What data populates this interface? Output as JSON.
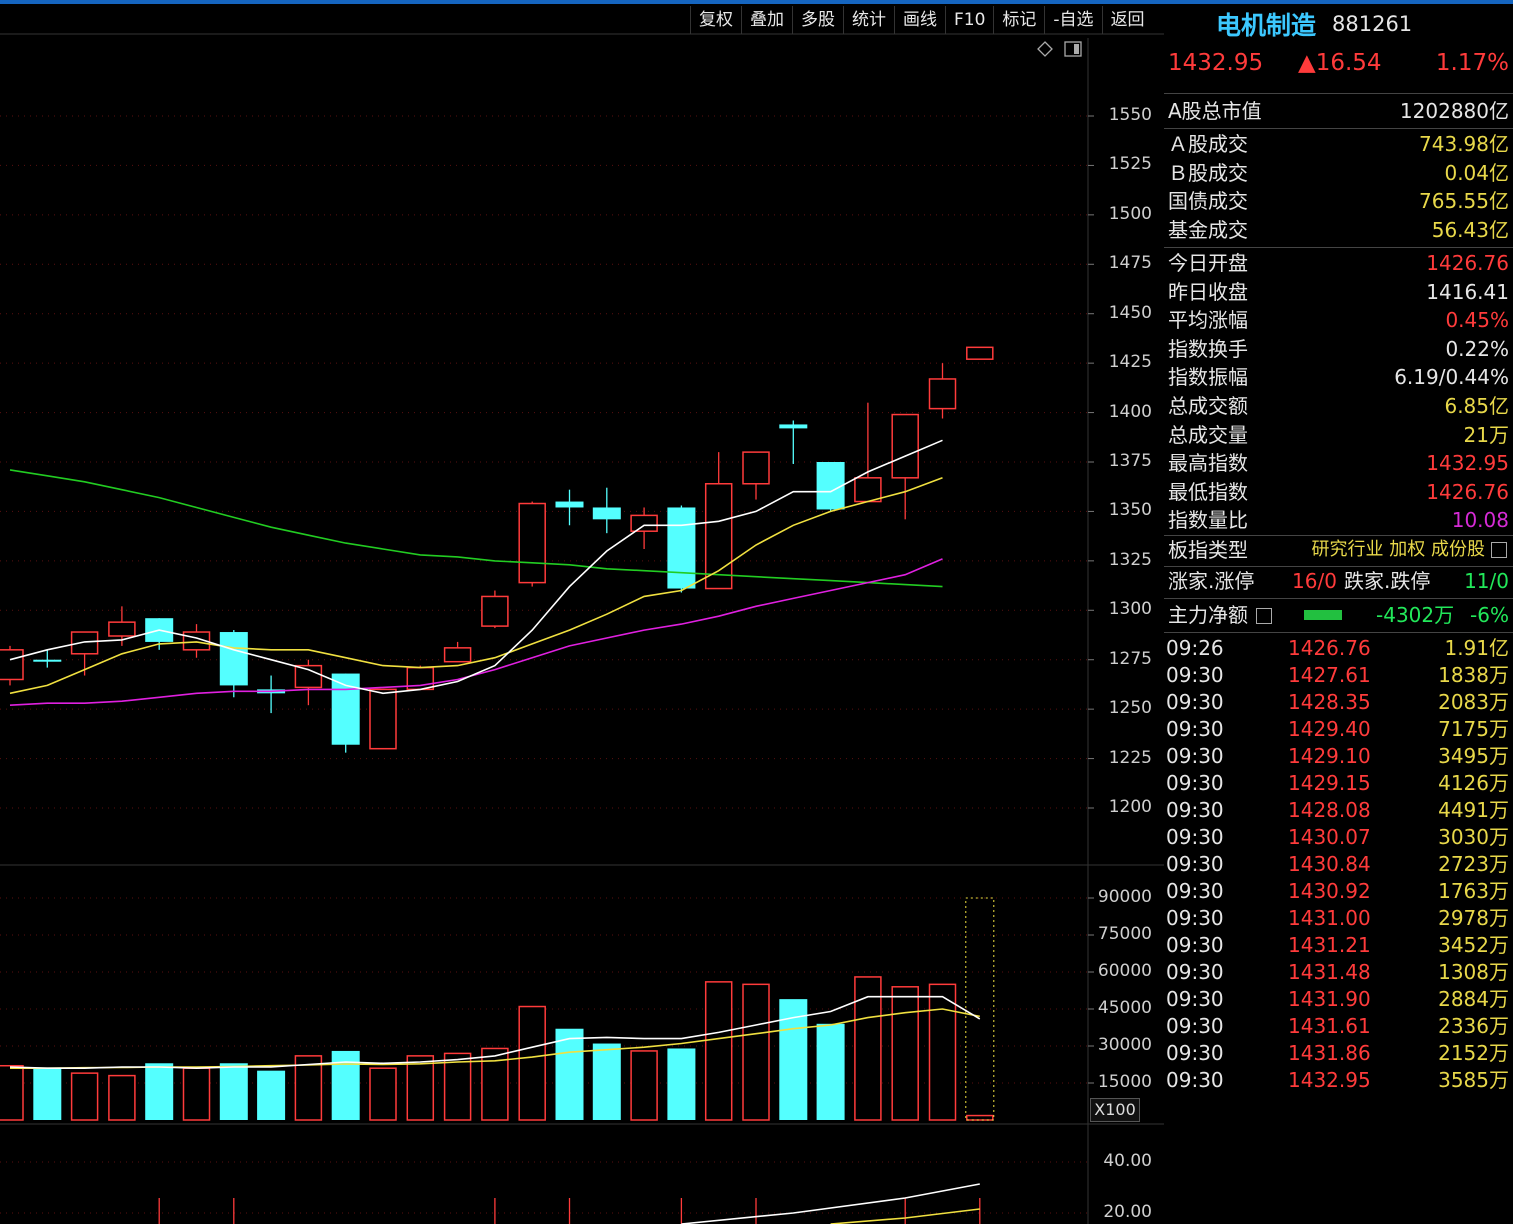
{
  "toolbar": {
    "items": [
      "复权",
      "叠加",
      "多股",
      "统计",
      "画线",
      "F10",
      "标记",
      "-自选",
      "返回"
    ]
  },
  "header": {
    "name": "电机制造",
    "code": "881261"
  },
  "quote": {
    "price": "1432.95",
    "change": "▲16.54",
    "pct": "1.17%"
  },
  "stats_top": [
    {
      "k": "A股总市值",
      "v": "1202880亿",
      "c": "wht"
    }
  ],
  "stats_a": [
    {
      "k": "Ａ股成交",
      "v": "743.98亿",
      "c": "yel"
    },
    {
      "k": "Ｂ股成交",
      "v": "0.04亿",
      "c": "yel"
    },
    {
      "k": "国债成交",
      "v": "765.55亿",
      "c": "yel"
    },
    {
      "k": "基金成交",
      "v": "56.43亿",
      "c": "yel"
    }
  ],
  "stats_b": [
    {
      "k": "今日开盘",
      "v": "1426.76",
      "c": "red"
    },
    {
      "k": "昨日收盘",
      "v": "1416.41",
      "c": "wht"
    },
    {
      "k": "平均涨幅",
      "v": "0.45%",
      "c": "red"
    },
    {
      "k": "指数换手",
      "v": "0.22%",
      "c": "wht"
    },
    {
      "k": "指数振幅",
      "v": "6.19/0.44%",
      "c": "wht"
    },
    {
      "k": "总成交额",
      "v": "6.85亿",
      "c": "yel"
    },
    {
      "k": "总成交量",
      "v": "21万",
      "c": "yel"
    },
    {
      "k": "最高指数",
      "v": "1432.95",
      "c": "red"
    },
    {
      "k": "最低指数",
      "v": "1426.76",
      "c": "red"
    },
    {
      "k": "指数量比",
      "v": "10.08",
      "c": "mag"
    }
  ],
  "board": {
    "k": "板指类型",
    "v": "研究行业 加权 成份股"
  },
  "updown": {
    "up_label": "涨家.涨停",
    "up_val": "16/0",
    "down_label": "跌家.跌停",
    "down_val": "11/0"
  },
  "mainflow": {
    "k": "主力净额",
    "amount": "-4302万",
    "pct": "-6%"
  },
  "ticks": [
    [
      "09:26",
      "1426.76",
      "1.91亿"
    ],
    [
      "09:30",
      "1427.61",
      "1838万"
    ],
    [
      "09:30",
      "1428.35",
      "2083万"
    ],
    [
      "09:30",
      "1429.40",
      "7175万"
    ],
    [
      "09:30",
      "1429.10",
      "3495万"
    ],
    [
      "09:30",
      "1429.15",
      "4126万"
    ],
    [
      "09:30",
      "1428.08",
      "4491万"
    ],
    [
      "09:30",
      "1430.07",
      "3030万"
    ],
    [
      "09:30",
      "1430.84",
      "2723万"
    ],
    [
      "09:30",
      "1430.92",
      "1763万"
    ],
    [
      "09:30",
      "1431.00",
      "2978万"
    ],
    [
      "09:30",
      "1431.21",
      "3452万"
    ],
    [
      "09:30",
      "1431.48",
      "1308万"
    ],
    [
      "09:30",
      "1431.90",
      "2884万"
    ],
    [
      "09:30",
      "1431.61",
      "2336万"
    ],
    [
      "09:30",
      "1431.86",
      "2152万"
    ],
    [
      "09:30",
      "1432.95",
      "3585万"
    ]
  ],
  "colors": {
    "up": "#ff3b3b",
    "down": "#54ffff",
    "ma5": "#ffffff",
    "ma10": "#f0e040",
    "ma20": "#e020e0",
    "ma60": "#22cc22",
    "grid": "#5a1010"
  },
  "chart_data": [
    {
      "type": "candlestick",
      "price_axis_ticks": [
        "1550",
        "1525",
        "1500",
        "1475",
        "1450",
        "1425",
        "1400",
        "1375",
        "1350",
        "1325",
        "1300",
        "1275",
        "1250",
        "1225",
        "1200"
      ],
      "ylim": [
        1200,
        1550
      ],
      "candles": [
        {
          "o": 1265,
          "h": 1282,
          "l": 1262,
          "c": 1280
        },
        {
          "o": 1275,
          "h": 1280,
          "l": 1271,
          "c": 1274
        },
        {
          "o": 1278,
          "h": 1289,
          "l": 1267,
          "c": 1289
        },
        {
          "o": 1287,
          "h": 1302,
          "l": 1282,
          "c": 1294
        },
        {
          "o": 1296,
          "h": 1296,
          "l": 1280,
          "c": 1284
        },
        {
          "o": 1280,
          "h": 1293,
          "l": 1276,
          "c": 1289
        },
        {
          "o": 1289,
          "h": 1290,
          "l": 1256,
          "c": 1262
        },
        {
          "o": 1260,
          "h": 1267,
          "l": 1248,
          "c": 1258
        },
        {
          "o": 1261,
          "h": 1275,
          "l": 1252,
          "c": 1272
        },
        {
          "o": 1268,
          "h": 1268,
          "l": 1228,
          "c": 1232
        },
        {
          "o": 1230,
          "h": 1260,
          "l": 1230,
          "c": 1260
        },
        {
          "o": 1260,
          "h": 1272,
          "l": 1260,
          "c": 1271
        },
        {
          "o": 1274,
          "h": 1284,
          "l": 1274,
          "c": 1281
        },
        {
          "o": 1292,
          "h": 1310,
          "l": 1291,
          "c": 1307
        },
        {
          "o": 1314,
          "h": 1355,
          "l": 1312,
          "c": 1354
        },
        {
          "o": 1355,
          "h": 1361,
          "l": 1343,
          "c": 1352
        },
        {
          "o": 1352,
          "h": 1362,
          "l": 1339,
          "c": 1346
        },
        {
          "o": 1340,
          "h": 1352,
          "l": 1331,
          "c": 1348
        },
        {
          "o": 1352,
          "h": 1353,
          "l": 1309,
          "c": 1311
        },
        {
          "o": 1311,
          "h": 1380,
          "l": 1311,
          "c": 1364
        },
        {
          "o": 1364,
          "h": 1379,
          "l": 1356,
          "c": 1380
        },
        {
          "o": 1394,
          "h": 1396,
          "l": 1374,
          "c": 1392
        },
        {
          "o": 1375,
          "h": 1375,
          "l": 1350,
          "c": 1351
        },
        {
          "o": 1355,
          "h": 1405,
          "l": 1355,
          "c": 1367
        },
        {
          "o": 1367,
          "h": 1371,
          "l": 1346,
          "c": 1399
        },
        {
          "o": 1402,
          "h": 1425,
          "l": 1397,
          "c": 1417
        },
        {
          "o": 1427,
          "h": 1433,
          "l": 1427,
          "c": 1433
        }
      ],
      "ma5": [
        1275,
        1280,
        1284,
        1285,
        1290,
        1286,
        1280,
        1275,
        1270,
        1262,
        1258,
        1260,
        1264,
        1272,
        1290,
        1312,
        1330,
        1343,
        1343,
        1345,
        1350,
        1360,
        1360,
        1370,
        1378,
        1386,
        1396
      ],
      "ma10": [
        1258,
        1262,
        1270,
        1278,
        1283,
        1284,
        1281,
        1280,
        1280,
        1276,
        1272,
        1271,
        1272,
        1276,
        1283,
        1290,
        1298,
        1307,
        1310,
        1320,
        1333,
        1343,
        1350,
        1355,
        1360,
        1367,
        1378
      ],
      "ma20": [
        1252,
        1253,
        1253,
        1254,
        1256,
        1258,
        1259,
        1259,
        1260,
        1260,
        1261,
        1262,
        1265,
        1270,
        1276,
        1282,
        1286,
        1290,
        1293,
        1297,
        1302,
        1306,
        1310,
        1314,
        1318,
        1326,
        1334
      ],
      "ma60": [
        1371,
        1368,
        1365,
        1361,
        1357,
        1352,
        1347,
        1342,
        1338,
        1334,
        1331,
        1328,
        1327,
        1325,
        1324,
        1323,
        1321,
        1320,
        1319,
        1318,
        1317,
        1316,
        1315,
        1314,
        1313,
        1312,
        1311
      ]
    },
    {
      "type": "bar",
      "title": "",
      "volume_axis_ticks": [
        "90000",
        "75000",
        "60000",
        "45000",
        "30000",
        "15000"
      ],
      "unit_label": "X100",
      "ylim": [
        0,
        90000
      ],
      "values": [
        22000,
        21000,
        19000,
        18000,
        23000,
        21000,
        23000,
        20000,
        26000,
        28000,
        21000,
        26000,
        27000,
        29000,
        46000,
        37000,
        31000,
        28000,
        29000,
        56000,
        55000,
        49000,
        39000,
        58000,
        54000,
        55000,
        1800
      ],
      "ma5": [
        21500,
        21000,
        21000,
        21500,
        21500,
        21000,
        21500,
        21500,
        22500,
        23500,
        23000,
        23500,
        24500,
        26000,
        29500,
        33000,
        33500,
        33000,
        33000,
        35500,
        38500,
        41500,
        44000,
        50000,
        50000,
        50000,
        41000
      ],
      "ma10": [
        21000,
        21000,
        21200,
        21300,
        21500,
        21500,
        21700,
        22000,
        22300,
        22700,
        22500,
        22800,
        23500,
        24000,
        25500,
        27500,
        28500,
        29500,
        31000,
        33000,
        35000,
        37000,
        38500,
        41500,
        43500,
        45000,
        42000
      ]
    },
    {
      "type": "line",
      "indicator_axis_ticks": [
        "40.00",
        "20.00"
      ],
      "ylim": [
        10,
        50
      ]
    }
  ]
}
